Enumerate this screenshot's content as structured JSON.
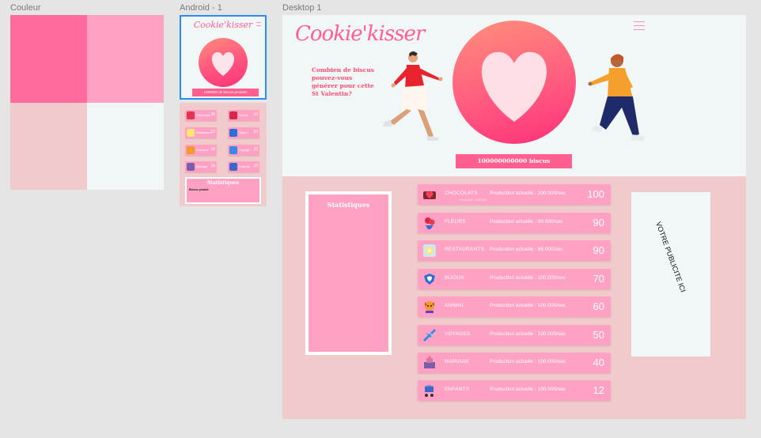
{
  "frames": {
    "couleur": "Couleur",
    "android": "Android - 1",
    "desktop": "Desktop 1"
  },
  "palette": [
    "#ff6b9d",
    "#ffa1c2",
    "#f1cbcb",
    "#f1f6f6"
  ],
  "colors": {
    "accent": "#ff5e8e",
    "pink_light": "#ffa1c2",
    "blush": "#f1cbcb",
    "off_white": "#f1f6f6",
    "selection": "#2c8cf4"
  },
  "desktop": {
    "logo": "Cookie'kisser",
    "question_lines": [
      "Combien de biscus",
      "pouvez-vous",
      "générer pour cette",
      "St Valentin?"
    ],
    "counter_button": "100000000000 biscus",
    "stats_title": "Statistiques",
    "ad_text": "VOTRE PUBLICITE ICI",
    "items": [
      {
        "category": "CHOCOLATS",
        "production": "Production actuelle : 100.000/sec",
        "value": "100",
        "icon": "chocolate-box-icon",
        "sub": "Prix actuel: 1.000.000"
      },
      {
        "category": "FLEURS",
        "production": "Production actuelle : 90.000/sec",
        "value": "90",
        "icon": "flower-bouquet-icon"
      },
      {
        "category": "RESTAURANTS",
        "production": "Production actuelle : 86.000/sec",
        "value": "90",
        "icon": "restaurant-plate-icon"
      },
      {
        "category": "BIJOUX",
        "production": "Production actuelle : 100.000/sec",
        "value": "70",
        "icon": "jewelry-icon"
      },
      {
        "category": "ANIMAL",
        "production": "Production actuelle : 100.000/sec",
        "value": "60",
        "icon": "dog-icon"
      },
      {
        "category": "VOYAGES",
        "production": "Production actuelle : 100.000/sec",
        "value": "50",
        "icon": "airplane-icon"
      },
      {
        "category": "MARIAGE",
        "production": "Production actuelle : 100.000/sec",
        "value": "40",
        "icon": "wedding-icon"
      },
      {
        "category": "ENFANTS",
        "production": "Production actuelle : 100.000/sec",
        "value": "12",
        "icon": "stroller-icon"
      }
    ]
  },
  "android": {
    "logo": "Cookie'kisser",
    "counter_button": "1000000 de biscus produits",
    "stats_title": "Statistiques",
    "stats_sub": "Biscus produit",
    "items": [
      {
        "category": "Chocolats",
        "value": "10"
      },
      {
        "category": "Fleurs",
        "value": "10"
      },
      {
        "category": "Restaurant",
        "value": "10"
      },
      {
        "category": "Bijoux",
        "value": "10"
      },
      {
        "category": "Animaux",
        "value": "10"
      },
      {
        "category": "Voyage",
        "value": "10"
      },
      {
        "category": "Mariage",
        "value": "10"
      },
      {
        "category": "Enfants",
        "value": "10"
      }
    ]
  }
}
